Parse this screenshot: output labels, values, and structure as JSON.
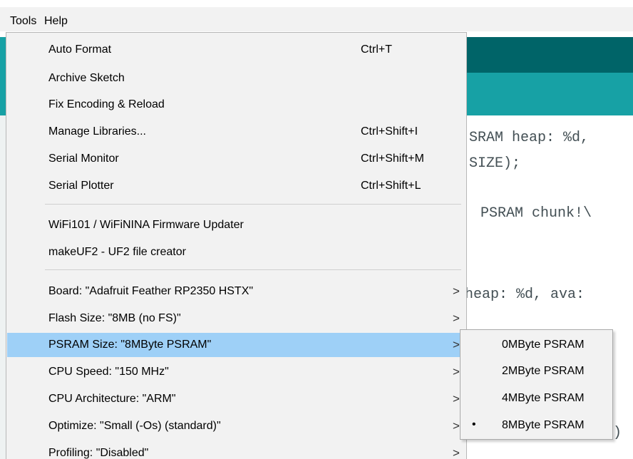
{
  "menubar": {
    "tools": "Tools",
    "help": "Help"
  },
  "editor": {
    "code_lines": [
      "SRAM heap: %d,",
      "SIZE);",
      "PSRAM chunk!\\",
      "heap: %d, ava:"
    ],
    "paren": ")"
  },
  "tools_menu": {
    "items": [
      {
        "label": "Auto Format",
        "shortcut": "Ctrl+T"
      },
      {
        "label": "Archive Sketch",
        "shortcut": ""
      },
      {
        "label": "Fix Encoding & Reload",
        "shortcut": ""
      },
      {
        "label": "Manage Libraries...",
        "shortcut": "Ctrl+Shift+I"
      },
      {
        "label": "Serial Monitor",
        "shortcut": "Ctrl+Shift+M"
      },
      {
        "label": "Serial Plotter",
        "shortcut": "Ctrl+Shift+L"
      },
      {
        "label": "WiFi101 / WiFiNINA Firmware Updater",
        "shortcut": ""
      },
      {
        "label": "makeUF2 - UF2 file creator",
        "shortcut": ""
      },
      {
        "label": "Board: \"Adafruit Feather RP2350 HSTX\"",
        "arrow": ">"
      },
      {
        "label": "Flash Size: \"8MB (no FS)\"",
        "arrow": ">"
      },
      {
        "label": "PSRAM Size: \"8MByte PSRAM\"",
        "arrow": ">"
      },
      {
        "label": "CPU Speed: \"150 MHz\"",
        "arrow": ">"
      },
      {
        "label": "CPU Architecture: \"ARM\"",
        "arrow": ">"
      },
      {
        "label": "Optimize: \"Small (-Os) (standard)\"",
        "arrow": ">"
      },
      {
        "label": "Profiling: \"Disabled\"",
        "arrow": ">"
      }
    ]
  },
  "psram_submenu": {
    "items": [
      {
        "label": "0MByte PSRAM",
        "bullet": ""
      },
      {
        "label": "2MByte PSRAM",
        "bullet": ""
      },
      {
        "label": "4MByte PSRAM",
        "bullet": ""
      },
      {
        "label": "8MByte PSRAM",
        "bullet": "•"
      }
    ]
  },
  "colors": {
    "highlight": "#9ed0f7",
    "teal_dark": "#006468",
    "teal_light": "#17a1a5",
    "menu_bg": "#f2f2f2"
  }
}
